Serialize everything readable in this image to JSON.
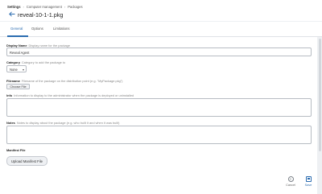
{
  "breadcrumb": {
    "root": "Settings",
    "items": [
      "Computer management",
      "Packages"
    ],
    "separator": "›"
  },
  "header": {
    "back_icon": "arrow-left-icon",
    "title": "reveal-10-1-1.pkg"
  },
  "tabs": [
    {
      "label": "General",
      "active": true
    },
    {
      "label": "Options",
      "active": false
    },
    {
      "label": "Limitations",
      "active": false
    }
  ],
  "form": {
    "display_name": {
      "label": "Display Name",
      "hint": "Display name for the package",
      "value": "Reveal Agent"
    },
    "category": {
      "label": "Category",
      "hint": "Category to add the package to",
      "value": "None"
    },
    "filename": {
      "label": "Filename",
      "hint": "Filename of the package on the distribution point (e.g. \"MyPackage.pkg\")",
      "button_label": "Choose File"
    },
    "info": {
      "label": "Info",
      "hint": "Information to display to the administrator when the package is deployed or uninstalled",
      "value": ""
    },
    "notes": {
      "label": "Notes",
      "hint": "Notes to display about the package (e.g. who built it and when it was built)",
      "value": ""
    },
    "manifest": {
      "label": "Manifest File",
      "button_label": "Upload Manifest File"
    }
  },
  "footer": {
    "cancel_label": "Cancel",
    "cancel_icon": "cancel-circle-icon",
    "save_label": "Save",
    "save_icon": "save-icon"
  },
  "colors": {
    "accent": "#2b6cb0",
    "background": "#eef0f3",
    "border": "#b7bcc3"
  }
}
